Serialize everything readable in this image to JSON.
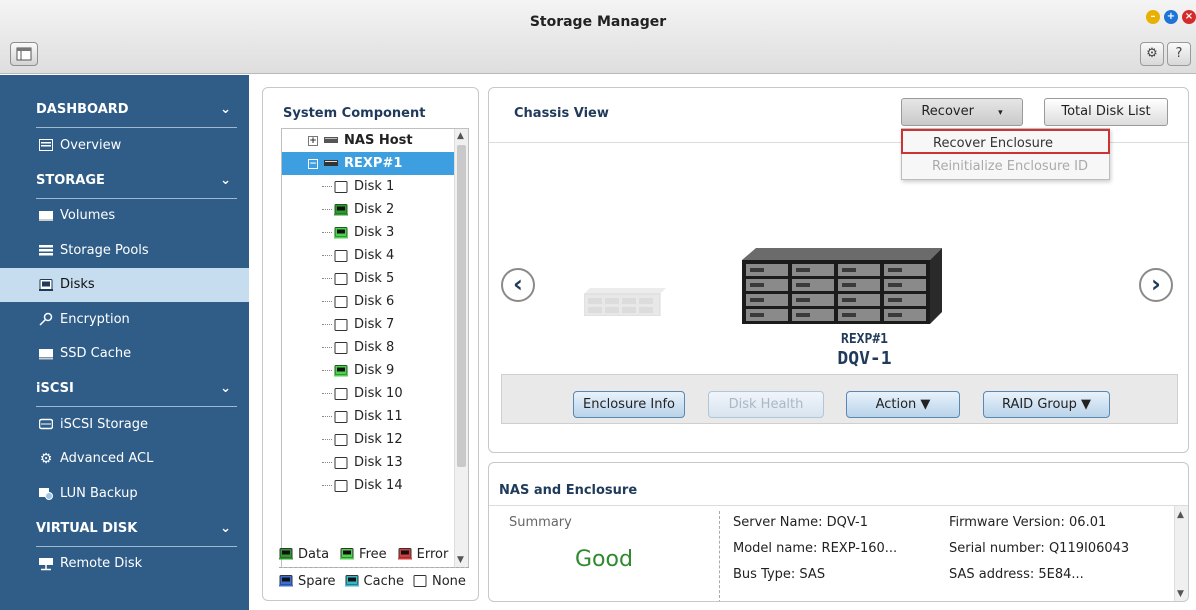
{
  "window": {
    "title": "Storage Manager"
  },
  "toolbar": {
    "settings_icon": "gear-icon",
    "help_label": "?"
  },
  "sidebar": {
    "sections": [
      {
        "label": "DASHBOARD",
        "items": [
          {
            "label": "Overview",
            "icon": "overview-icon"
          }
        ]
      },
      {
        "label": "STORAGE",
        "items": [
          {
            "label": "Volumes",
            "icon": "volume-icon"
          },
          {
            "label": "Storage Pools",
            "icon": "storage-pool-icon"
          },
          {
            "label": "Disks",
            "icon": "disk-icon",
            "active": true
          },
          {
            "label": "Encryption",
            "icon": "key-icon"
          },
          {
            "label": "SSD Cache",
            "icon": "ssd-icon"
          }
        ]
      },
      {
        "label": "iSCSI",
        "items": [
          {
            "label": "iSCSI Storage",
            "icon": "iscsi-icon"
          },
          {
            "label": "Advanced ACL",
            "icon": "acl-icon"
          },
          {
            "label": "LUN Backup",
            "icon": "lun-backup-icon"
          }
        ]
      },
      {
        "label": "VIRTUAL DISK",
        "items": [
          {
            "label": "Remote Disk",
            "icon": "remote-disk-icon"
          }
        ]
      }
    ]
  },
  "system_component": {
    "title": "System Component",
    "tree": {
      "host": "NAS Host",
      "enclosure": "REXP#1",
      "disks": [
        {
          "label": "Disk 1",
          "state": "none"
        },
        {
          "label": "Disk 2",
          "state": "data"
        },
        {
          "label": "Disk 3",
          "state": "free"
        },
        {
          "label": "Disk 4",
          "state": "none"
        },
        {
          "label": "Disk 5",
          "state": "none"
        },
        {
          "label": "Disk 6",
          "state": "none"
        },
        {
          "label": "Disk 7",
          "state": "none"
        },
        {
          "label": "Disk 8",
          "state": "none"
        },
        {
          "label": "Disk 9",
          "state": "free"
        },
        {
          "label": "Disk 10",
          "state": "none"
        },
        {
          "label": "Disk 11",
          "state": "none"
        },
        {
          "label": "Disk 12",
          "state": "none"
        },
        {
          "label": "Disk 13",
          "state": "none"
        },
        {
          "label": "Disk 14",
          "state": "none"
        }
      ]
    },
    "legend": [
      {
        "label": "Data",
        "color": "#2e9a2e"
      },
      {
        "label": "Free",
        "color": "#4fd24f"
      },
      {
        "label": "Error",
        "color": "#d83b3b"
      },
      {
        "label": "Spare",
        "color": "#3b6fd8"
      },
      {
        "label": "Cache",
        "color": "#37b8c8"
      },
      {
        "label": "None",
        "color": "#ffffff"
      }
    ]
  },
  "chassis_view": {
    "title": "Chassis View",
    "recover_label": "Recover",
    "total_disk_list_label": "Total Disk List",
    "dropdown": {
      "items": [
        {
          "label": "Recover Enclosure",
          "enabled": true,
          "highlighted": true
        },
        {
          "label": "Reinitialize Enclosure ID",
          "enabled": false
        }
      ]
    },
    "enclosure_name": "REXP#1",
    "enclosure_model": "DQV-1",
    "buttons": {
      "enclosure_info": "Enclosure Info",
      "disk_health": "Disk Health",
      "action": "Action ▼",
      "raid_group": "RAID Group ▼"
    }
  },
  "nas_enclosure": {
    "title": "NAS and Enclosure",
    "summary_label": "Summary",
    "summary_status": "Good",
    "fields": [
      "Server Name: DQV-1",
      "Firmware Version: 06.01",
      "Model name: REXP-160...",
      "Serial number: Q119I06043",
      "Bus Type: SAS",
      "SAS address: 5E84..."
    ]
  },
  "colors": {
    "sidebar_bg": "#305d88",
    "active_item_bg": "#c6dcef",
    "selected_tree_bg": "#3d9ee0",
    "status_good": "#2f8a2f",
    "highlight_border": "#cc3333"
  }
}
